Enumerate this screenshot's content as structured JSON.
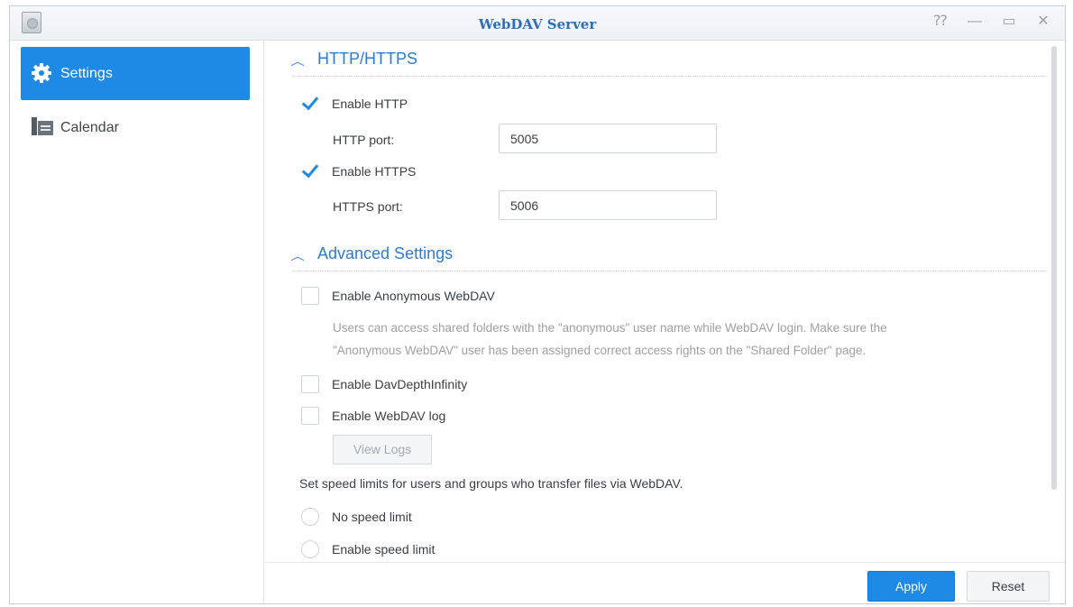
{
  "window": {
    "title": "WebDAV Server"
  },
  "window_controls": [
    {
      "name": "help-icon",
      "glyph": "⁇"
    },
    {
      "name": "minimize-icon",
      "glyph": "—"
    },
    {
      "name": "maximize-icon",
      "glyph": "▭"
    },
    {
      "name": "close-icon",
      "glyph": "✕"
    }
  ],
  "sidebar": {
    "items": [
      {
        "label": "Settings",
        "icon": "gear-icon",
        "active": true
      },
      {
        "label": "Calendar",
        "icon": "calendar-icon",
        "active": false
      }
    ]
  },
  "http_section": {
    "title": "HTTP/HTTPS",
    "enable_http": {
      "label": "Enable HTTP",
      "checked": true
    },
    "http_port": {
      "label": "HTTP port:",
      "value": "5005"
    },
    "enable_https": {
      "label": "Enable HTTPS",
      "checked": true
    },
    "https_port": {
      "label": "HTTPS port:",
      "value": "5006"
    }
  },
  "advanced_section": {
    "title": "Advanced Settings",
    "anonymous": {
      "label": "Enable Anonymous WebDAV",
      "checked": false
    },
    "anonymous_desc_line1": "Users can access shared folders with the \"anonymous\" user name while WebDAV login. Make sure the",
    "anonymous_desc_line2": "\"Anonymous WebDAV\" user has been assigned correct access rights on the \"Shared Folder\" page.",
    "depth_infinity": {
      "label": "Enable DavDepthInfinity",
      "checked": false
    },
    "webdav_log": {
      "label": "Enable WebDAV log",
      "checked": false
    },
    "view_logs_label": "View Logs"
  },
  "speed": {
    "intro": "Set speed limits for users and groups who transfer files via WebDAV.",
    "options": [
      {
        "label": "No speed limit",
        "selected": false
      },
      {
        "label": "Enable speed limit",
        "selected": false
      }
    ]
  },
  "footer": {
    "apply_label": "Apply",
    "reset_label": "Reset"
  },
  "colors": {
    "accent": "#1e8ae6",
    "title": "#2f6fb6",
    "section": "#2f7bd0"
  }
}
